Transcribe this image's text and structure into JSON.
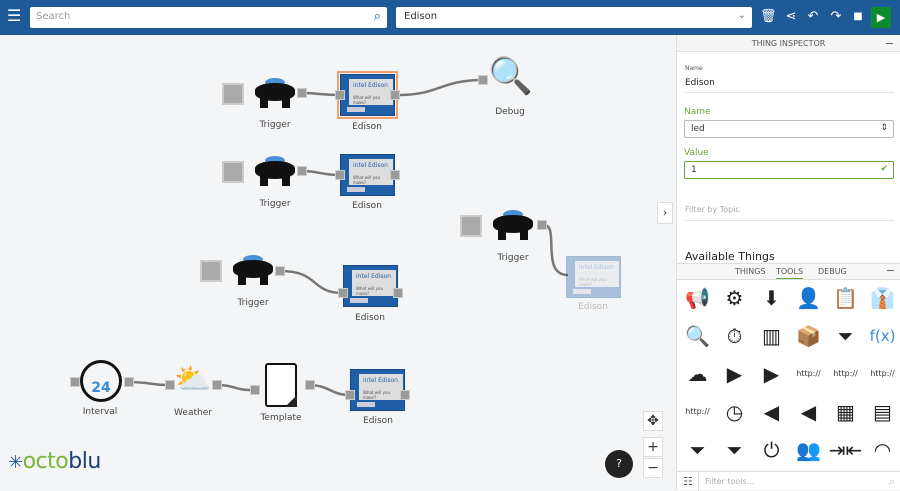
{
  "topbar": {
    "search_placeholder": "Search",
    "flow_name": "Edison",
    "icons": [
      "menu-icon",
      "search-icon",
      "chevron-down-icon",
      "trash-icon",
      "share-icon",
      "undo-icon",
      "redo-icon",
      "stop-icon",
      "play-icon"
    ],
    "play_color": "#0d8b2c",
    "bar_color": "#1d5a97"
  },
  "canvas": {
    "nodes": {
      "trigger": "Trigger",
      "edison": "Edison",
      "debug": "Debug",
      "interval": "Interval",
      "weather": "Weather",
      "template": "Template"
    },
    "edison_chip": "intel Edison",
    "edison_tag": "What will you make?",
    "interval_num": "24",
    "help": "?"
  },
  "logo": {
    "part1": "octo",
    "part2": "blu"
  },
  "inspector": {
    "title": "THING INSPECTOR",
    "name_small": "Name",
    "name_value": "Edison",
    "name_label": "Name",
    "name_field": "led",
    "value_label": "Value",
    "value_field": "1",
    "filter_placeholder": "Filter by Topic",
    "available": "Available Things"
  },
  "tabs": {
    "things": "THINGS",
    "tools": "TOOLS",
    "debug": "DEBUG",
    "active": "TOOLS"
  },
  "tools": [
    {
      "icon": "megaphone-icon",
      "g": "📢"
    },
    {
      "icon": "gear-badge-icon",
      "g": "⚙"
    },
    {
      "icon": "download-circle-icon",
      "g": "⬇"
    },
    {
      "icon": "person-info-icon",
      "g": "👤"
    },
    {
      "icon": "clipboard-icon",
      "g": "📋"
    },
    {
      "icon": "tie-icon",
      "g": "👔"
    },
    {
      "icon": "search-gear-icon",
      "g": "🔍"
    },
    {
      "icon": "stopwatch-gear-icon",
      "g": "⏱"
    },
    {
      "icon": "columns-icon",
      "g": "▥"
    },
    {
      "icon": "box-icon",
      "g": "📦"
    },
    {
      "icon": "funnel-icon",
      "g": "⏷"
    },
    {
      "icon": "function-icon",
      "g": "f(x)"
    },
    {
      "icon": "cloud-download-icon",
      "g": "☁"
    },
    {
      "icon": "funnel-right-icon",
      "g": "▶"
    },
    {
      "icon": "funnel-right-icon-2",
      "g": "▶"
    },
    {
      "icon": "http-delete-icon",
      "g": "http://"
    },
    {
      "icon": "http-post-icon",
      "g": "http://"
    },
    {
      "icon": "http-put-icon",
      "g": "http://"
    },
    {
      "icon": "http-get-icon",
      "g": "http://"
    },
    {
      "icon": "interval-24-icon",
      "g": "◷"
    },
    {
      "icon": "funnel-left-icon",
      "g": "◀"
    },
    {
      "icon": "funnel-left-icon-2",
      "g": "◀"
    },
    {
      "icon": "calculator-icon",
      "g": "▦"
    },
    {
      "icon": "switches-icon",
      "g": "▤"
    },
    {
      "icon": "funnel-equal-icon",
      "g": "⏷"
    },
    {
      "icon": "funnel-circle-icon",
      "g": "⏷"
    },
    {
      "icon": "plug-icon",
      "g": "⏻"
    },
    {
      "icon": "people-search-icon",
      "g": "👥"
    },
    {
      "icon": "compress-icon",
      "g": "⇥⇤"
    },
    {
      "icon": "rss-icon",
      "g": "◠"
    }
  ],
  "filter_tools_placeholder": "Filter tools..."
}
